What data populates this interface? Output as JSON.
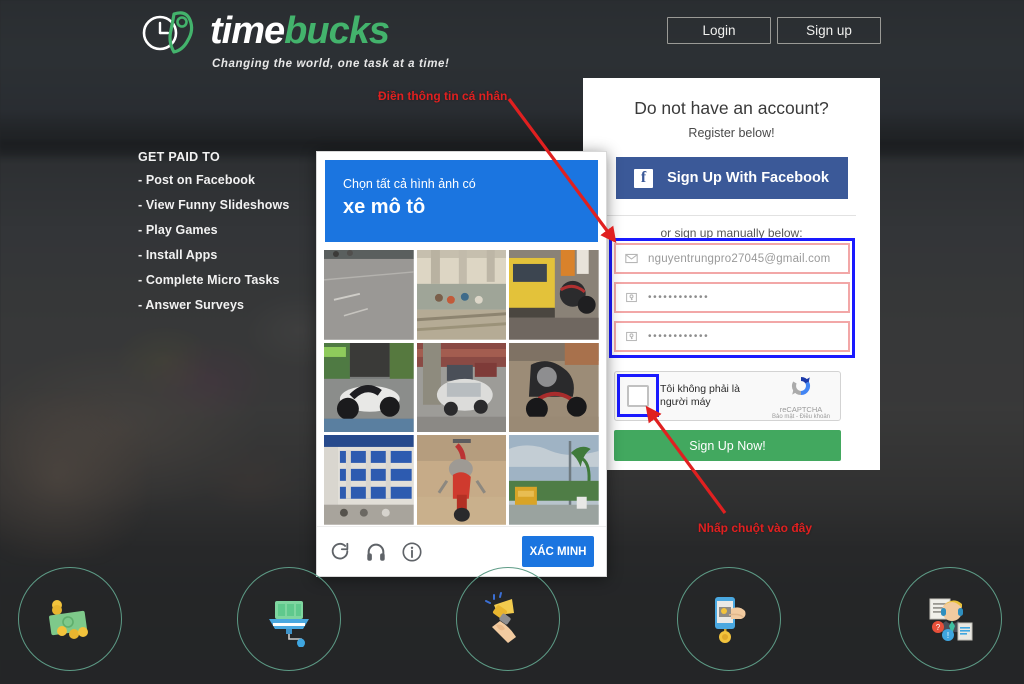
{
  "page": {
    "site_name": "timebucks",
    "logo_word_part1": "time",
    "logo_word_part2": "bucks",
    "tagline": "Changing the world, one task at a time!",
    "brand_green": "#43b36c",
    "background_overlay": "#202224"
  },
  "header": {
    "login_label": "Login",
    "signup_label": "Sign up"
  },
  "get_paid_to": {
    "title": "GET PAID TO",
    "items": [
      "- Post on Facebook",
      "- View Funny Slideshows",
      "- Play Games",
      "- Install Apps",
      "- Complete Micro Tasks",
      "- Answer Surveys"
    ]
  },
  "register": {
    "heading": "Do not have an account?",
    "subheading": "Register below!",
    "facebook_button_label": "Sign Up With Facebook",
    "facebook_icon_glyph": "f",
    "facebook_color": "#3b5998",
    "manual_label": "or sign up manually below:",
    "fields": [
      {
        "name": "email",
        "icon": "envelope-icon",
        "value": "nguyentrungpro27045@gmail.com",
        "masked": false
      },
      {
        "name": "password",
        "icon": "key-icon",
        "value": "••••••••••••",
        "masked": true
      },
      {
        "name": "confirm-password",
        "icon": "key-icon",
        "value": "••••••••••••",
        "masked": true
      }
    ],
    "field_border_color": "#f2a7a7",
    "submit_label": "Sign Up Now!",
    "submit_color": "#42a85f"
  },
  "recaptcha": {
    "checkbox_label": "Tôi không phải là người máy",
    "brand_name": "reCAPTCHA",
    "brand_links": "Bảo mật - Điều khoản",
    "checked": false
  },
  "captcha_dialog": {
    "instruction": "Chọn tất cả hình ảnh có",
    "target": "xe mô tô",
    "header_color": "#1b75e0",
    "verify_label": "XÁC MINH",
    "tools": [
      {
        "name": "reload-icon",
        "label": "reload"
      },
      {
        "name": "audio-challenge-icon",
        "label": "audio"
      },
      {
        "name": "info-icon",
        "label": "info"
      }
    ],
    "tiles": [
      {
        "index": 1,
        "description": "empty asphalt road",
        "selected": false
      },
      {
        "index": 2,
        "description": "market under overpass",
        "selected": false
      },
      {
        "index": 3,
        "description": "yellow bus and motorbike",
        "selected": false
      },
      {
        "index": 4,
        "description": "parked white motorbike",
        "selected": false
      },
      {
        "index": 5,
        "description": "row of parked cars",
        "selected": false
      },
      {
        "index": 6,
        "description": "black motorbike on dirt",
        "selected": false
      },
      {
        "index": 7,
        "description": "blue office building",
        "selected": false
      },
      {
        "index": 8,
        "description": "red dirt bike rider",
        "selected": false
      },
      {
        "index": 9,
        "description": "roadside with palm trees",
        "selected": false
      }
    ]
  },
  "annotations": {
    "fill_info": "Điền thông tin cá nhân",
    "click_here": "Nhấp chuột vào đây",
    "color": "#e02020",
    "box_color": "#1a1aff"
  },
  "feature_circles": [
    {
      "name": "cash-money-icon",
      "label": "money"
    },
    {
      "name": "computer-monitor-icon",
      "label": "computer"
    },
    {
      "name": "megaphone-icon",
      "label": "promote"
    },
    {
      "name": "mobile-tap-icon",
      "label": "mobile app"
    },
    {
      "name": "survey-agent-icon",
      "label": "surveys"
    }
  ]
}
